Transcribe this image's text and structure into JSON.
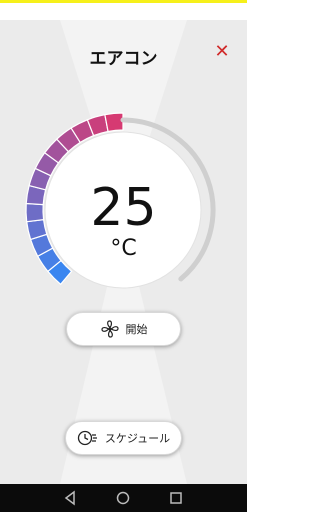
{
  "header": {
    "title": "エアコン",
    "close_icon": "close-icon"
  },
  "dial": {
    "temperature": "25",
    "unit": "°C",
    "level": 0.5,
    "colors": {
      "cool": "#3a86f0",
      "warm": "#d63a72",
      "track": "#cfcfcf"
    }
  },
  "buttons": {
    "start_label": "開始",
    "start_icon": "fan-icon",
    "schedule_label": "スケジュール",
    "schedule_icon": "clock-schedule-icon"
  },
  "navbar": {
    "back": "back-icon",
    "home": "home-icon",
    "recent": "recent-apps-icon"
  }
}
